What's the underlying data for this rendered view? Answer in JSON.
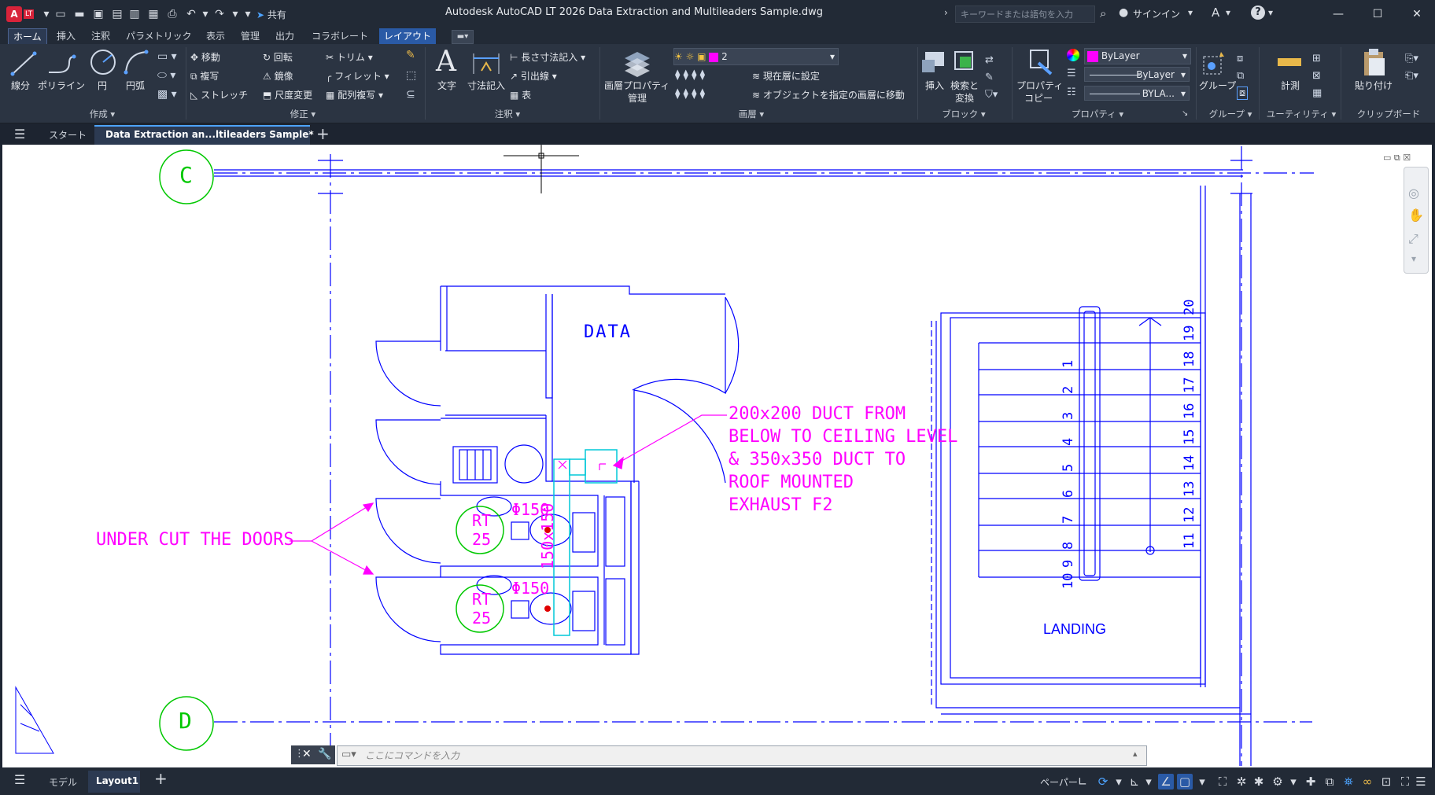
{
  "titlebar": {
    "app_badge": "A",
    "lt_badge": "LT",
    "share": "共有",
    "title": "Autodesk AutoCAD LT 2026    Data Extraction and Multileaders Sample.dwg",
    "search_placeholder": "キーワードまたは語句を入力",
    "signin": "サインイン"
  },
  "ribbon_tabs": [
    "ホーム",
    "挿入",
    "注釈",
    "パラメトリック",
    "表示",
    "管理",
    "出力",
    "コラボレート",
    "レイアウト"
  ],
  "panels": {
    "create": {
      "name": "作成",
      "line": "線分",
      "polyline": "ポリライン",
      "circle": "円",
      "arc": "円弧"
    },
    "modify": {
      "name": "修正",
      "move": "移動",
      "rotate": "回転",
      "trim": "トリム",
      "copy": "複写",
      "mirror": "鏡像",
      "fillet": "フィレット",
      "stretch": "ストレッチ",
      "scale": "尺度変更",
      "array": "配列複写"
    },
    "annotation": {
      "name": "注釈",
      "text": "文字",
      "dimension": "寸法記入",
      "linear": "長さ寸法記入",
      "leader": "引出線",
      "table": "表"
    },
    "layers": {
      "name": "画層",
      "props": "画層プロパティ",
      "manage": "管理",
      "current_layer": "2",
      "set_current": "現在層に設定",
      "move_to_layer": "オブジェクトを指定の画層に移動"
    },
    "block": {
      "name": "ブロック",
      "insert": "挿入",
      "search": "検索と",
      "replace": "変換"
    },
    "properties": {
      "name": "プロパティ",
      "copy": "プロパティ",
      "copy2": "コピー",
      "color": "ByLayer",
      "linetype": "ByLayer",
      "lineweight": "BYLA..."
    },
    "groups": {
      "name": "グループ",
      "group": "グループ"
    },
    "utilities": {
      "name": "ユーティリティ",
      "measure": "計測"
    },
    "clipboard": {
      "name": "クリップボード",
      "paste": "貼り付け"
    }
  },
  "doc_tabs": {
    "start": "スタート",
    "active": "Data Extraction an...ltileaders Sample*"
  },
  "drawing": {
    "grid_c": "C",
    "grid_d": "D",
    "room_label": "DATA",
    "duct_note": [
      "200x200 DUCT FROM",
      "BELOW TO CEILING LEVEL",
      "& 350x350 DUCT TO",
      "ROOF MOUNTED",
      "EXHAUST F2"
    ],
    "door_note": "UNDER CUT THE DOORS",
    "rt_label": "RT",
    "rt_num": "25",
    "pipe_label": "Φ150",
    "duct_vert": "150x150",
    "stair_left": [
      "1",
      "2",
      "3",
      "4",
      "5",
      "6",
      "7",
      "8",
      "9",
      "10"
    ],
    "stair_right": [
      "11",
      "12",
      "13",
      "14",
      "15",
      "16",
      "17",
      "18",
      "19",
      "20"
    ],
    "landing": "LANDING"
  },
  "command_placeholder": "ここにコマンドを入力",
  "status": {
    "model": "モデル",
    "layout1": "Layout1",
    "paper": "ペーパー"
  },
  "colors": {
    "accent": "#2a5aa6",
    "drawing_blue": "#0000ff",
    "magenta": "#ff00ff",
    "green": "#00c000",
    "cyan": "#00e0e0"
  }
}
